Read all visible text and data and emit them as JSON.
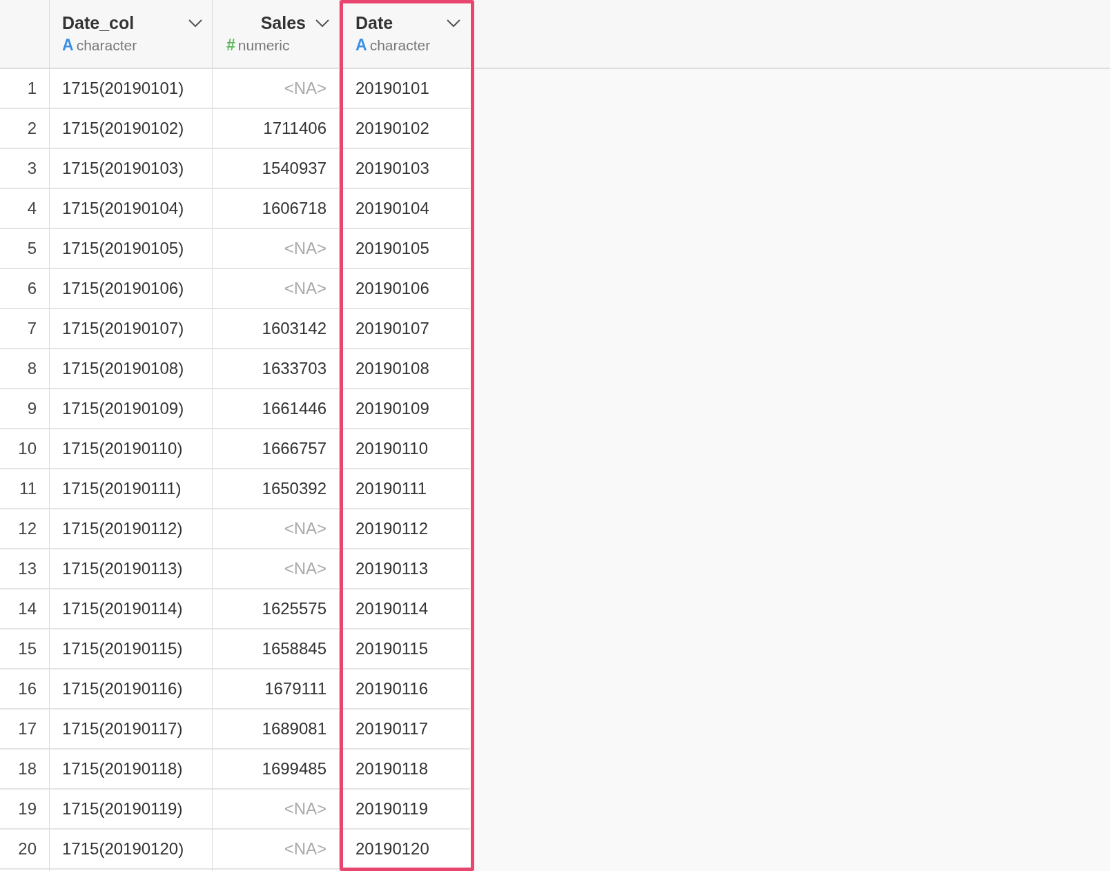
{
  "columns": [
    {
      "name": "Date_col",
      "type": "character",
      "type_icon": "A",
      "highlighted": false
    },
    {
      "name": "Sales",
      "type": "numeric",
      "type_icon": "#",
      "highlighted": false
    },
    {
      "name": "Date",
      "type": "character",
      "type_icon": "A",
      "highlighted": true
    }
  ],
  "rows": [
    {
      "number": "1",
      "date_col": "1715(20190101)",
      "sales": "<NA>",
      "sales_missing": true,
      "date": "20190101"
    },
    {
      "number": "2",
      "date_col": "1715(20190102)",
      "sales": "1711406",
      "sales_missing": false,
      "date": "20190102"
    },
    {
      "number": "3",
      "date_col": "1715(20190103)",
      "sales": "1540937",
      "sales_missing": false,
      "date": "20190103"
    },
    {
      "number": "4",
      "date_col": "1715(20190104)",
      "sales": "1606718",
      "sales_missing": false,
      "date": "20190104"
    },
    {
      "number": "5",
      "date_col": "1715(20190105)",
      "sales": "<NA>",
      "sales_missing": true,
      "date": "20190105"
    },
    {
      "number": "6",
      "date_col": "1715(20190106)",
      "sales": "<NA>",
      "sales_missing": true,
      "date": "20190106"
    },
    {
      "number": "7",
      "date_col": "1715(20190107)",
      "sales": "1603142",
      "sales_missing": false,
      "date": "20190107"
    },
    {
      "number": "8",
      "date_col": "1715(20190108)",
      "sales": "1633703",
      "sales_missing": false,
      "date": "20190108"
    },
    {
      "number": "9",
      "date_col": "1715(20190109)",
      "sales": "1661446",
      "sales_missing": false,
      "date": "20190109"
    },
    {
      "number": "10",
      "date_col": "1715(20190110)",
      "sales": "1666757",
      "sales_missing": false,
      "date": "20190110"
    },
    {
      "number": "11",
      "date_col": "1715(20190111)",
      "sales": "1650392",
      "sales_missing": false,
      "date": "20190111"
    },
    {
      "number": "12",
      "date_col": "1715(20190112)",
      "sales": "<NA>",
      "sales_missing": true,
      "date": "20190112"
    },
    {
      "number": "13",
      "date_col": "1715(20190113)",
      "sales": "<NA>",
      "sales_missing": true,
      "date": "20190113"
    },
    {
      "number": "14",
      "date_col": "1715(20190114)",
      "sales": "1625575",
      "sales_missing": false,
      "date": "20190114"
    },
    {
      "number": "15",
      "date_col": "1715(20190115)",
      "sales": "1658845",
      "sales_missing": false,
      "date": "20190115"
    },
    {
      "number": "16",
      "date_col": "1715(20190116)",
      "sales": "1679111",
      "sales_missing": false,
      "date": "20190116"
    },
    {
      "number": "17",
      "date_col": "1715(20190117)",
      "sales": "1689081",
      "sales_missing": false,
      "date": "20190117"
    },
    {
      "number": "18",
      "date_col": "1715(20190118)",
      "sales": "1699485",
      "sales_missing": false,
      "date": "20190118"
    },
    {
      "number": "19",
      "date_col": "1715(20190119)",
      "sales": "<NA>",
      "sales_missing": true,
      "date": "20190119"
    },
    {
      "number": "20",
      "date_col": "1715(20190120)",
      "sales": "<NA>",
      "sales_missing": true,
      "date": "20190120"
    }
  ]
}
